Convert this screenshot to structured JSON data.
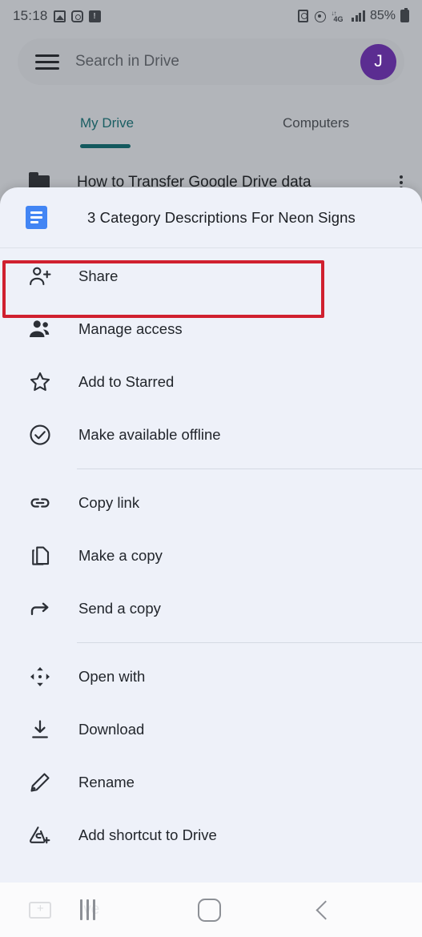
{
  "status_bar": {
    "time": "15:18",
    "left_icons": [
      "photos-icon",
      "instagram-icon",
      "notification-icon"
    ],
    "network_label": "4G",
    "battery_percent": "85%",
    "right_icons": [
      "alarm-battery-icon",
      "hotspot-icon",
      "network-4g-icon",
      "signal-bars-icon",
      "battery-icon"
    ]
  },
  "search": {
    "placeholder": "Search in Drive",
    "menu_icon": "hamburger-icon",
    "avatar_initial": "J"
  },
  "tabs": [
    {
      "label": "My Drive",
      "selected": true
    },
    {
      "label": "Computers",
      "selected": false
    }
  ],
  "background_list": [
    {
      "name": "How to Transfer Google Drive data",
      "icon": "folder-icon"
    }
  ],
  "sheet": {
    "file_title": "3 Category Descriptions For Neon Signs",
    "file_icon": "google-docs-icon",
    "groups": [
      {
        "items": [
          {
            "label": "Share",
            "icon": "person-add-icon",
            "highlighted": true
          },
          {
            "label": "Manage access",
            "icon": "people-icon",
            "highlighted": false
          },
          {
            "label": "Add to Starred",
            "icon": "star-outline-icon",
            "highlighted": false
          },
          {
            "label": "Make available offline",
            "icon": "check-circle-icon",
            "highlighted": false
          }
        ]
      },
      {
        "items": [
          {
            "label": "Copy link",
            "icon": "link-icon",
            "highlighted": false
          },
          {
            "label": "Make a copy",
            "icon": "copy-icon",
            "highlighted": false
          },
          {
            "label": "Send a copy",
            "icon": "share-arrow-icon",
            "highlighted": false
          }
        ]
      },
      {
        "items": [
          {
            "label": "Open with",
            "icon": "open-with-icon",
            "highlighted": false
          },
          {
            "label": "Download",
            "icon": "download-icon",
            "highlighted": false
          },
          {
            "label": "Rename",
            "icon": "pencil-icon",
            "highlighted": false
          },
          {
            "label": "Add shortcut to Drive",
            "icon": "add-shortcut-icon",
            "highlighted": false
          }
        ]
      }
    ]
  },
  "nav_bar": {
    "ghost_label": "ive",
    "buttons": [
      "recents-button",
      "home-button",
      "back-button"
    ]
  },
  "colors": {
    "highlight_box": "#d0202f",
    "accent_teal": "#13595e",
    "docs_blue": "#4285f4",
    "avatar_purple": "#5b2d91",
    "sheet_bg": "#eef1f9",
    "scrim": "#b2b5ba"
  }
}
